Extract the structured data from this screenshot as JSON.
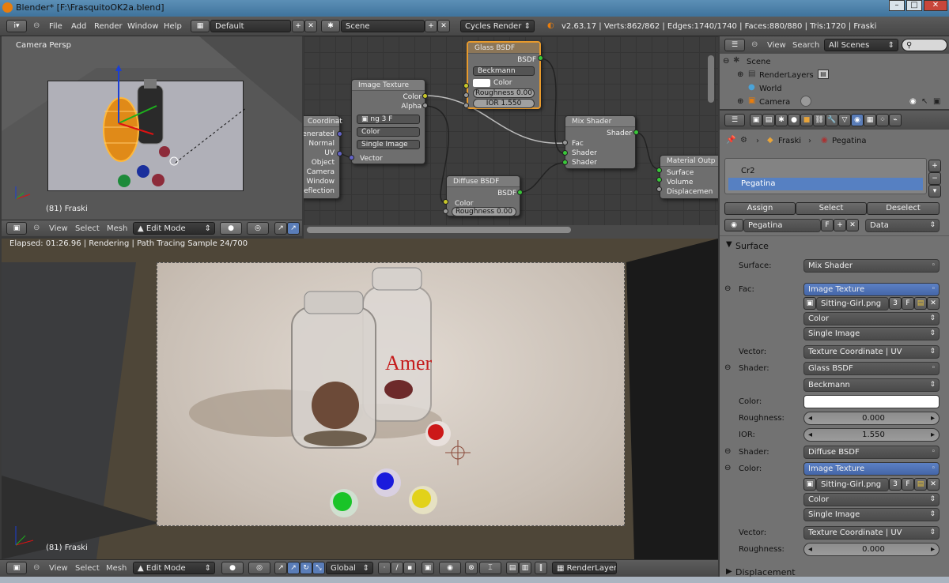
{
  "window": {
    "title": "Blender* [F:\\FrasquitoOK2a.blend]",
    "controls": [
      "–",
      "□",
      "✕"
    ]
  },
  "menubar": {
    "items": [
      "File",
      "Add",
      "Render",
      "Window",
      "Help"
    ],
    "layout": "Default",
    "scene": "Scene",
    "engine": "Cycles Render",
    "stats": "v2.63.17 | Verts:862/862 | Edges:1740/1740 | Faces:880/880 | Tris:1720 | Fraski"
  },
  "viewport3d": {
    "label": "Camera Persp",
    "object_label": "(81) Fraski",
    "header": {
      "view": "View",
      "select": "Select",
      "mesh": "Mesh",
      "mode": "Edit Mode"
    }
  },
  "nodes": {
    "image_texture": {
      "title": "Image Texture",
      "outputs": [
        "Color",
        "Alpha"
      ],
      "img": "ng",
      "users": "3",
      "F": "F",
      "color": "Color",
      "proj": "Single Image",
      "input": "Vector"
    },
    "coord": {
      "title": "Coordinat",
      "outputs": [
        "Generated",
        "Normal",
        "UV",
        "Object",
        "Camera",
        "Window",
        "Reflection"
      ]
    },
    "glass": {
      "title": "Glass BSDF",
      "output": "BSDF",
      "dist": "Beckmann",
      "color": "Color",
      "roughness": "Roughness 0.00",
      "ior": "IOR 1.550"
    },
    "diffuse": {
      "title": "Diffuse BSDF",
      "output": "BSDF",
      "color": "Color",
      "roughness": "Roughness 0.00"
    },
    "mix": {
      "title": "Mix Shader",
      "output": "Shader",
      "inputs": [
        "Fac",
        "Shader",
        "Shader"
      ]
    },
    "material": {
      "title": "Material Outp",
      "inputs": [
        "Surface",
        "Volume",
        "Displacemen"
      ]
    }
  },
  "render": {
    "status": "Elapsed: 01:26.96 | Rendering | Path Tracing Sample 24/700",
    "object_label": "(81) Fraski",
    "bottle_text": "Amer"
  },
  "bottom_header": {
    "view": "View",
    "select": "Select",
    "mesh": "Mesh",
    "mode": "Edit Mode",
    "orientation": "Global",
    "layer": "RenderLayer"
  },
  "outliner": {
    "view": "View",
    "search": "Search",
    "filter": "All Scenes",
    "items": [
      "Scene",
      "RenderLayers",
      "World",
      "Camera"
    ]
  },
  "properties": {
    "breadcrumb": [
      "Fraski",
      "Pegatina"
    ],
    "slots": [
      "Cr2",
      "Pegatina"
    ],
    "assign": "Assign",
    "select": "Select",
    "deselect": "Deselect",
    "material_name": "Pegatina",
    "F": "F",
    "data": "Data",
    "panel": "Surface",
    "rows": [
      {
        "label": "Surface:",
        "value": "Mix Shader"
      },
      {
        "label": "Fac:",
        "value": "Image Texture"
      },
      {
        "label": "",
        "value": "Sitting-Girl.png",
        "users": "3",
        "F": "F"
      },
      {
        "label": "",
        "value": "Color"
      },
      {
        "label": "",
        "value": "Single Image"
      },
      {
        "label": "Vector:",
        "value": "Texture Coordinate | UV"
      },
      {
        "label": "Shader:",
        "value": "Glass BSDF"
      },
      {
        "label": "",
        "value": "Beckmann"
      },
      {
        "label": "Color:",
        "value": ""
      },
      {
        "label": "Roughness:",
        "value": "0.000"
      },
      {
        "label": "IOR:",
        "value": "1.550"
      },
      {
        "label": "Shader:",
        "value": "Diffuse BSDF"
      },
      {
        "label": "Color:",
        "value": "Image Texture"
      },
      {
        "label": "",
        "value": "Sitting-Girl.png",
        "users": "3",
        "F": "F"
      },
      {
        "label": "",
        "value": "Color"
      },
      {
        "label": "",
        "value": "Single Image"
      },
      {
        "label": "Vector:",
        "value": "Texture Coordinate | UV"
      },
      {
        "label": "Roughness:",
        "value": "0.000"
      }
    ],
    "displacement": "Displacement"
  }
}
